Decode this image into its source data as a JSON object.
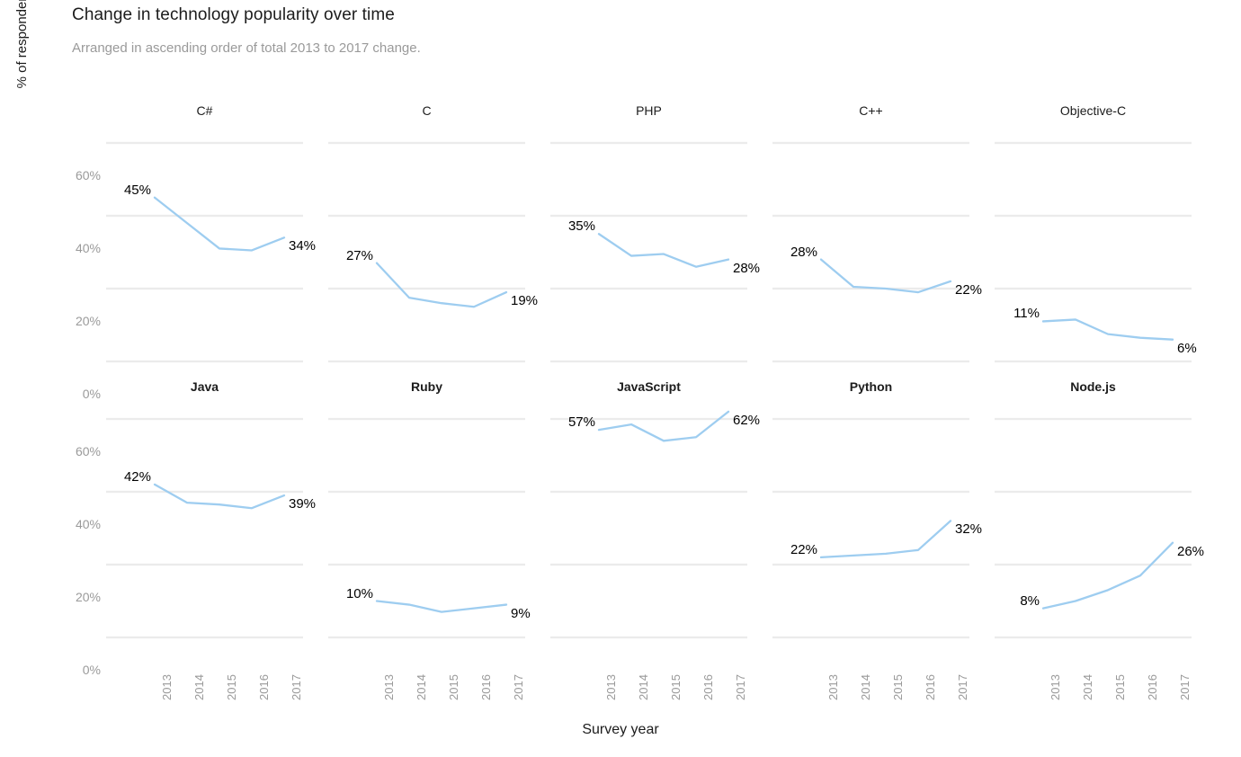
{
  "header": {
    "title": "Change in technology popularity over time",
    "subtitle": "Arranged in ascending order of total 2013 to 2017 change."
  },
  "axes": {
    "y_title": "% of respondents who work with this language or technology",
    "x_title": "Survey year",
    "y_ticks": [
      "60%",
      "40%",
      "20%",
      "0%"
    ],
    "x_ticks": [
      "2013",
      "2014",
      "2015",
      "2016",
      "2017"
    ]
  },
  "style": {
    "line_color": "#9ecdf0",
    "grid_color": "#ebebeb",
    "tick_color": "#9a9a9a",
    "title_color": "#1c1c1c",
    "subtitle_color": "#9a9a9a",
    "label_color": "#000000",
    "background": "#ffffff"
  },
  "chart_data": {
    "type": "line",
    "title": "Change in technology popularity over time",
    "subtitle": "Arranged in ascending order of total 2013 to 2017 change.",
    "xlabel": "Survey year",
    "ylabel": "% of respondents who work with this language or technology",
    "x": [
      2013,
      2014,
      2015,
      2016,
      2017
    ],
    "ylim": [
      0,
      65
    ],
    "y_ticks": [
      0,
      20,
      40,
      60
    ],
    "grid": true,
    "legend": "none",
    "layout": "small-multiples 2 rows x 5 columns",
    "facets": [
      {
        "name": "C#",
        "row": 1,
        "col": 1,
        "bold_title": false,
        "values": [
          45,
          38,
          31,
          30.5,
          34
        ],
        "start_label": "45%",
        "end_label": "34%"
      },
      {
        "name": "C",
        "row": 1,
        "col": 2,
        "bold_title": false,
        "values": [
          27,
          17.5,
          16,
          15,
          19
        ],
        "start_label": "27%",
        "end_label": "19%"
      },
      {
        "name": "PHP",
        "row": 1,
        "col": 3,
        "bold_title": false,
        "values": [
          35,
          29,
          29.5,
          26,
          28
        ],
        "start_label": "35%",
        "end_label": "28%"
      },
      {
        "name": "C++",
        "row": 1,
        "col": 4,
        "bold_title": false,
        "values": [
          28,
          20.5,
          20,
          19,
          22
        ],
        "start_label": "28%",
        "end_label": "22%"
      },
      {
        "name": "Objective-C",
        "row": 1,
        "col": 5,
        "bold_title": false,
        "values": [
          11,
          11.5,
          7.5,
          6.5,
          6
        ],
        "start_label": "11%",
        "end_label": "6%"
      },
      {
        "name": "Java",
        "row": 2,
        "col": 1,
        "bold_title": true,
        "values": [
          42,
          37,
          36.5,
          35.5,
          39
        ],
        "start_label": "42%",
        "end_label": "39%"
      },
      {
        "name": "Ruby",
        "row": 2,
        "col": 2,
        "bold_title": true,
        "values": [
          10,
          9,
          7,
          8,
          9
        ],
        "start_label": "10%",
        "end_label": "9%"
      },
      {
        "name": "JavaScript",
        "row": 2,
        "col": 3,
        "bold_title": true,
        "values": [
          57,
          58.5,
          54,
          55,
          62
        ],
        "start_label": "57%",
        "end_label": "62%"
      },
      {
        "name": "Python",
        "row": 2,
        "col": 4,
        "bold_title": true,
        "values": [
          22,
          22.5,
          23,
          24,
          32
        ],
        "start_label": "22%",
        "end_label": "32%"
      },
      {
        "name": "Node.js",
        "row": 2,
        "col": 5,
        "bold_title": true,
        "values": [
          8,
          10,
          13,
          17,
          26
        ],
        "start_label": "8%",
        "end_label": "26%"
      }
    ]
  }
}
